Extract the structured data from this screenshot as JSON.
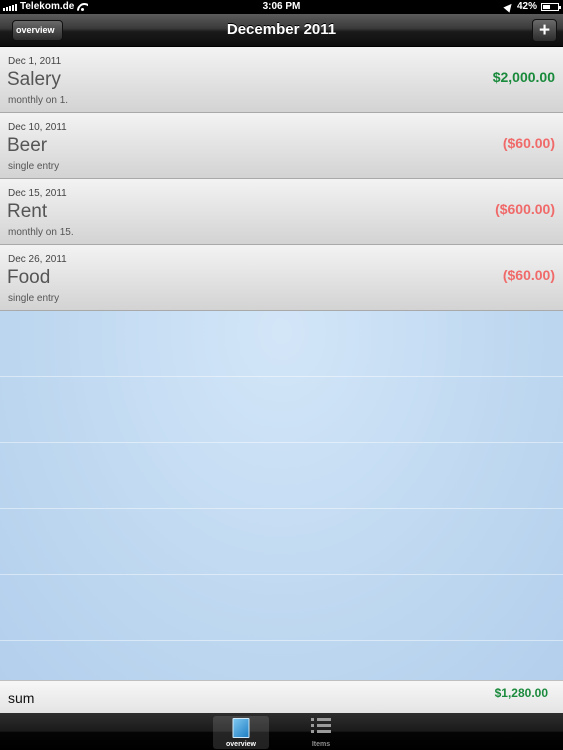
{
  "status_bar": {
    "carrier": "Telekom.de",
    "time": "3:06 PM",
    "battery": "42%",
    "battery_level": 0.42,
    "icons": [
      "signal-bars-icon",
      "wifi-icon",
      "location-arrow-icon",
      "battery-icon"
    ]
  },
  "nav": {
    "back_label": "overview",
    "title": "December 2011",
    "add_label": "+"
  },
  "entries": [
    {
      "date": "Dec 1, 2011",
      "name": "Salery",
      "recurrence": "monthly on 1.",
      "amount": "$2,000.00",
      "type": "income"
    },
    {
      "date": "Dec 10, 2011",
      "name": "Beer",
      "recurrence": "single entry",
      "amount": "($60.00)",
      "type": "expense"
    },
    {
      "date": "Dec 15, 2011",
      "name": "Rent",
      "recurrence": "monthly on 15.",
      "amount": "($600.00)",
      "type": "expense"
    },
    {
      "date": "Dec 26, 2011",
      "name": "Food",
      "recurrence": "single entry",
      "amount": "($60.00)",
      "type": "expense"
    }
  ],
  "sum": {
    "label": "sum",
    "value": "$1,280.00"
  },
  "tabs": [
    {
      "label": "overview",
      "icon": "overview-book-icon",
      "active": true
    },
    {
      "label": "Items",
      "icon": "list-icon",
      "active": false
    }
  ],
  "colors": {
    "income": "#1a8a3c",
    "expense": "#f06a6a",
    "sum": "#1a8a3c"
  }
}
